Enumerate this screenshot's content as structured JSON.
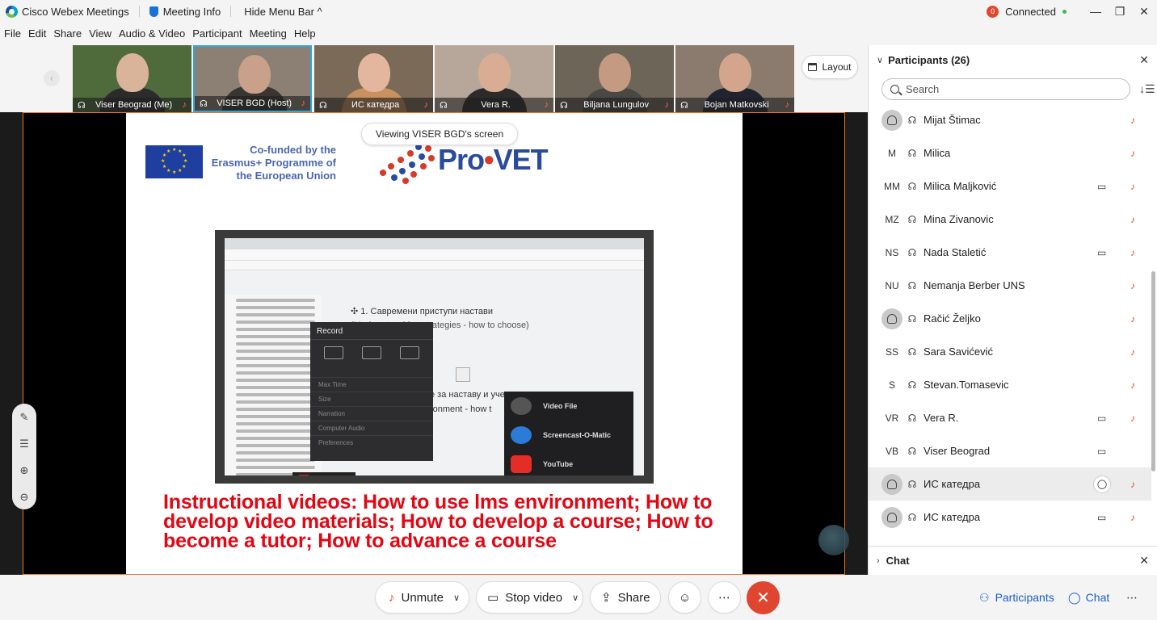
{
  "titlebar": {
    "app_name": "Cisco Webex Meetings",
    "meeting_info": "Meeting Info",
    "hide_menu": "Hide Menu Bar ^",
    "rec_badge": "0",
    "status": "Connected",
    "minimize": "—",
    "restore": "❐",
    "close": "✕"
  },
  "menu": [
    "File",
    "Edit",
    "Share",
    "View",
    "Audio & Video",
    "Participant",
    "Meeting",
    "Help"
  ],
  "thumbnails": [
    {
      "name": "Viser Beograd (Me)",
      "bg": "#4f6b3c",
      "skin": "#d9b39a",
      "shirt": "#2b2b2b"
    },
    {
      "name": "VISER BGD (Host)",
      "bg": "#8c7f74",
      "skin": "#c9a08a",
      "shirt": "#3a3530"
    },
    {
      "name": "ИС катедра",
      "bg": "#7b6a58",
      "skin": "#e2b79e",
      "shirt": "#c99060"
    },
    {
      "name": "Vera R.",
      "bg": "#b7a79a",
      "skin": "#d8ad94",
      "shirt": "#2e2a2a"
    },
    {
      "name": "Biljana Lungulov",
      "bg": "#6e6559",
      "skin": "#c49a83",
      "shirt": "#4a4845"
    },
    {
      "name": "Bojan Matkovski",
      "bg": "#8a7b6e",
      "skin": "#d2a58c",
      "shirt": "#1f2430"
    }
  ],
  "layout_label": "Layout",
  "viewing_text": "Viewing VISER BGD's screen",
  "slide": {
    "eu_text": "Co-funded by the Erasmus+ Programme of the European Union",
    "provet_word": "Pro",
    "provet_dot": "•",
    "provet_suffix": "VET",
    "ss_heading1": "✣ 1. Савремени приступи настави",
    "ss_heading2": "(Modern teaching strategies - how to choose)",
    "ss_heading3": "е за наставу и учење",
    "ss_heading4": "ronment - how t",
    "rec_title": "Record",
    "rec_modes": [
      "Screen",
      "Webcam",
      "Both"
    ],
    "rec_rows": [
      "Max Time",
      "Size",
      "Narration",
      "Computer Audio",
      "Preferences"
    ],
    "vid_options": [
      "Video File",
      "Screencast-O-Matic",
      "YouTube"
    ],
    "caption": "Instructional videos: How to use lms environment; How to develop video materials; How to develop a course; How to become a tutor; How to advance a course"
  },
  "controls": {
    "unmute": "Unmute",
    "stop_video": "Stop video",
    "share": "Share",
    "participants": "Participants",
    "chat": "Chat"
  },
  "panel": {
    "title": "Participants (26)",
    "search_placeholder": "Search",
    "chat_title": "Chat",
    "participants": [
      {
        "initials": "",
        "name": "Mijat Štimac",
        "video": false,
        "muted": true
      },
      {
        "initials": "M",
        "name": "Milica",
        "video": false,
        "muted": true
      },
      {
        "initials": "MM",
        "name": "Milica Maljković",
        "video": true,
        "muted": true
      },
      {
        "initials": "MZ",
        "name": "Mina Zivanovic",
        "video": false,
        "muted": true
      },
      {
        "initials": "NS",
        "name": "Nada Staletić",
        "video": true,
        "muted": true
      },
      {
        "initials": "NU",
        "name": "Nemanja Berber UNS",
        "video": false,
        "muted": true
      },
      {
        "initials": "",
        "name": "Račić Željko",
        "video": false,
        "muted": true
      },
      {
        "initials": "SS",
        "name": "Sara Savićević",
        "video": false,
        "muted": true
      },
      {
        "initials": "S",
        "name": "Stevan.Tomasevic",
        "video": false,
        "muted": true
      },
      {
        "initials": "VR",
        "name": "Vera R.",
        "video": true,
        "muted": true
      },
      {
        "initials": "VB",
        "name": "Viser Beograd",
        "video": true,
        "muted": false
      },
      {
        "initials": "",
        "name": "ИС катедра",
        "video": false,
        "muted": true,
        "highlight": true
      },
      {
        "initials": "",
        "name": "ИС катедра",
        "video": true,
        "muted": true
      }
    ]
  }
}
